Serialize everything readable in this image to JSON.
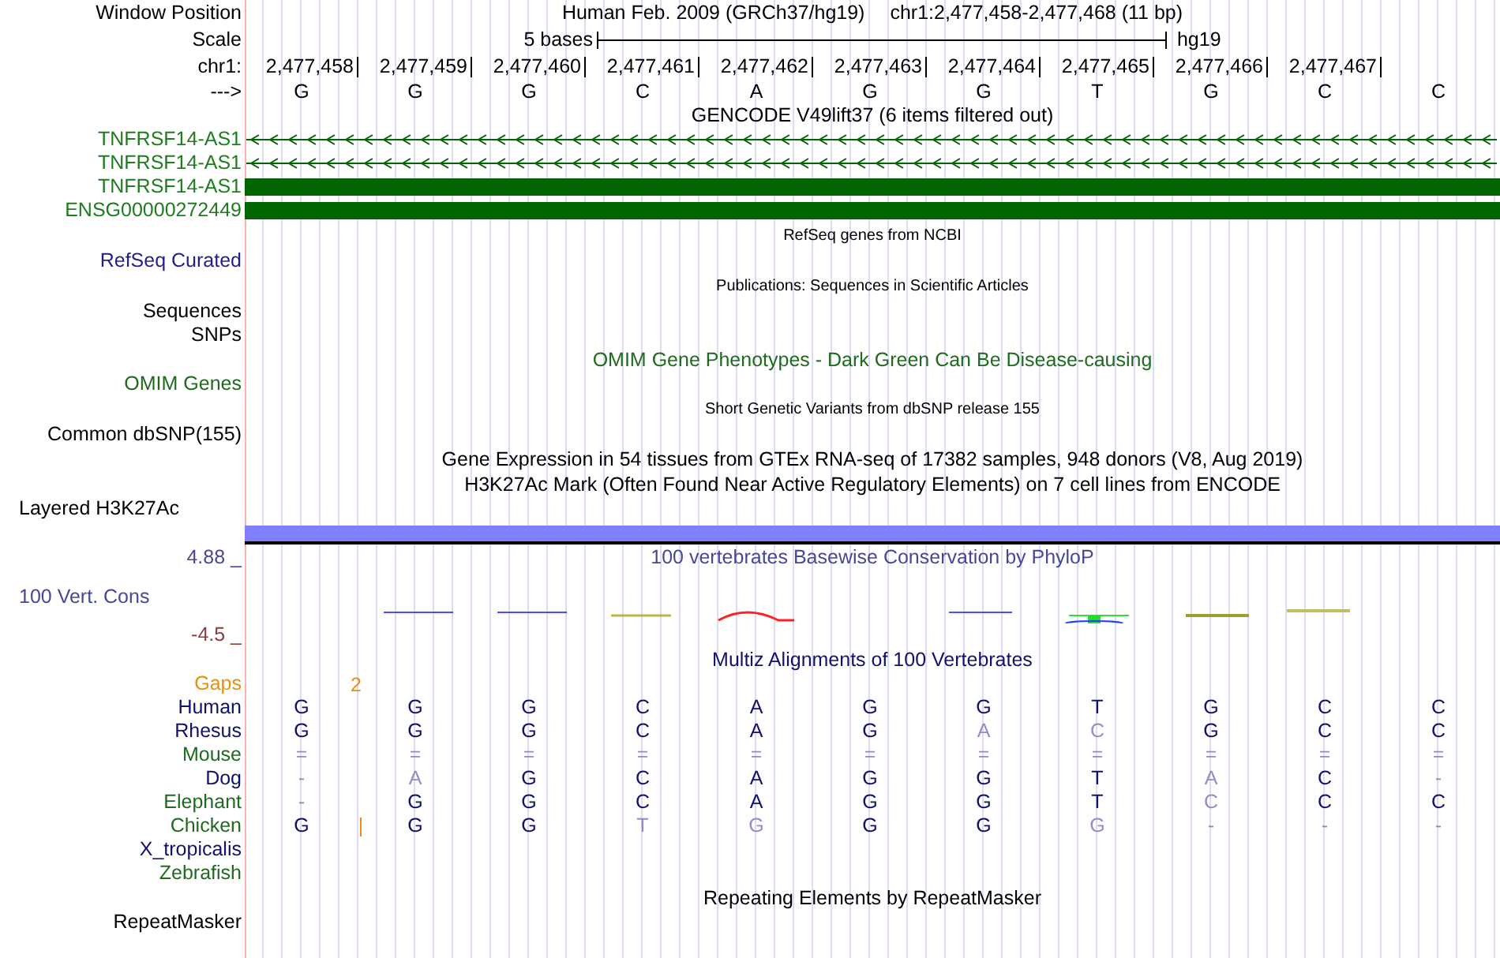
{
  "header": {
    "label": "Window Position",
    "assembly": "Human Feb. 2009 (GRCh37/hg19)",
    "position": "chr1:2,477,458-2,477,468 (11 bp)"
  },
  "scale": {
    "label": "Scale",
    "ruler_text": "5 bases",
    "assembly": "hg19"
  },
  "coordinates": {
    "label": "chr1:",
    "positions": [
      "2,477,458",
      "2,477,459",
      "2,477,460",
      "2,477,461",
      "2,477,462",
      "2,477,463",
      "2,477,464",
      "2,477,465",
      "2,477,466",
      "2,477,467"
    ]
  },
  "sequence": {
    "label": "--->",
    "bases": [
      "G",
      "G",
      "G",
      "C",
      "A",
      "G",
      "G",
      "T",
      "G",
      "C",
      "C"
    ]
  },
  "tracks": [
    {
      "kind": "title",
      "text": "GENCODE V49lift37 (6 items filtered out)",
      "color": "#000000"
    },
    {
      "kind": "gene-intron",
      "label": "TNFRSF14-AS1",
      "color": "#1e7d1e"
    },
    {
      "kind": "gene-intron",
      "label": "TNFRSF14-AS1",
      "color": "#1e7d1e"
    },
    {
      "kind": "gene-exon",
      "label": "TNFRSF14-AS1",
      "color": "#1e7d1e"
    },
    {
      "kind": "gene-exon",
      "label": "ENSG00000272449",
      "color": "#1e7d1e"
    },
    {
      "kind": "note",
      "text": "RefSeq genes from NCBI",
      "color": "#000000"
    },
    {
      "kind": "label",
      "label": "RefSeq Curated",
      "color": "#1f1f8c"
    },
    {
      "kind": "note",
      "text": "Publications: Sequences in Scientific Articles",
      "color": "#000000"
    },
    {
      "kind": "label",
      "label": "Sequences",
      "color": "#000000"
    },
    {
      "kind": "label",
      "label": "SNPs",
      "color": "#000000"
    },
    {
      "kind": "title",
      "text": "OMIM Gene Phenotypes - Dark Green Can Be Disease-causing",
      "color": "#1e6b1e"
    },
    {
      "kind": "label",
      "label": "OMIM Genes",
      "color": "#1e6b1e"
    },
    {
      "kind": "note",
      "text": "Short Genetic Variants from dbSNP release 155",
      "color": "#000000"
    },
    {
      "kind": "label",
      "label": "Common dbSNP(155)",
      "color": "#000000"
    },
    {
      "kind": "title",
      "text": "Gene Expression in 54 tissues from GTEx RNA-seq of 17382 samples, 948 donors (V8, Aug 2019)",
      "color": "#000000"
    },
    {
      "kind": "title",
      "text": "H3K27Ac Mark (Often Found Near Active Regulatory Elements) on 7 cell lines from ENCODE",
      "color": "#000000"
    },
    {
      "kind": "side-label",
      "label": "Layered H3K27Ac",
      "color": "#000000"
    },
    {
      "kind": "signal-bar",
      "color": "#7f7fff"
    },
    {
      "kind": "axis",
      "label": "4.88 _",
      "text": "100 vertebrates Basewise Conservation by PhyloP",
      "color": "#47479a"
    },
    {
      "kind": "wiggle",
      "label": "100 Vert. Cons",
      "color": "#47479a"
    },
    {
      "kind": "axis",
      "label": "-4.5 _",
      "color": "#8a3b3b"
    },
    {
      "kind": "title",
      "text": "Multiz Alignments of 100 Vertebrates",
      "color": "#10106e"
    },
    {
      "kind": "gaps",
      "label": "Gaps",
      "color": "#e8900a",
      "count": "2"
    },
    {
      "kind": "species",
      "label": "Human",
      "color": "#10106e",
      "bases": [
        {
          "b": "G",
          "faint": false
        },
        {
          "b": "G",
          "faint": false
        },
        {
          "b": "G",
          "faint": false
        },
        {
          "b": "C",
          "faint": false
        },
        {
          "b": "A",
          "faint": false
        },
        {
          "b": "G",
          "faint": false
        },
        {
          "b": "G",
          "faint": false
        },
        {
          "b": "T",
          "faint": false
        },
        {
          "b": "G",
          "faint": false
        },
        {
          "b": "C",
          "faint": false
        },
        {
          "b": "C",
          "faint": false
        }
      ]
    },
    {
      "kind": "species",
      "label": "Rhesus",
      "color": "#10106e",
      "bases": [
        {
          "b": "G",
          "faint": false
        },
        {
          "b": "G",
          "faint": false
        },
        {
          "b": "G",
          "faint": false
        },
        {
          "b": "C",
          "faint": false
        },
        {
          "b": "A",
          "faint": false
        },
        {
          "b": "G",
          "faint": false
        },
        {
          "b": "A",
          "faint": true
        },
        {
          "b": "C",
          "faint": true
        },
        {
          "b": "G",
          "faint": false
        },
        {
          "b": "C",
          "faint": false
        },
        {
          "b": "C",
          "faint": false
        }
      ]
    },
    {
      "kind": "species",
      "label": "Mouse",
      "color": "#1e6b1e",
      "bases": [
        {
          "b": "=",
          "faint": true
        },
        {
          "b": "=",
          "faint": true
        },
        {
          "b": "=",
          "faint": true
        },
        {
          "b": "=",
          "faint": true
        },
        {
          "b": "=",
          "faint": true
        },
        {
          "b": "=",
          "faint": true
        },
        {
          "b": "=",
          "faint": true
        },
        {
          "b": "=",
          "faint": true
        },
        {
          "b": "=",
          "faint": true
        },
        {
          "b": "=",
          "faint": true
        },
        {
          "b": "=",
          "faint": true
        }
      ]
    },
    {
      "kind": "species",
      "label": "Dog",
      "color": "#10106e",
      "bases": [
        {
          "b": "-",
          "faint": true
        },
        {
          "b": "A",
          "faint": true
        },
        {
          "b": "G",
          "faint": false
        },
        {
          "b": "C",
          "faint": false
        },
        {
          "b": "A",
          "faint": false
        },
        {
          "b": "G",
          "faint": false
        },
        {
          "b": "G",
          "faint": false
        },
        {
          "b": "T",
          "faint": false
        },
        {
          "b": "A",
          "faint": true
        },
        {
          "b": "C",
          "faint": false
        },
        {
          "b": "-",
          "faint": true
        }
      ]
    },
    {
      "kind": "species",
      "label": "Elephant",
      "color": "#1e6b1e",
      "bases": [
        {
          "b": "-",
          "faint": true
        },
        {
          "b": "G",
          "faint": false
        },
        {
          "b": "G",
          "faint": false
        },
        {
          "b": "C",
          "faint": false
        },
        {
          "b": "A",
          "faint": false
        },
        {
          "b": "G",
          "faint": false
        },
        {
          "b": "G",
          "faint": false
        },
        {
          "b": "T",
          "faint": false
        },
        {
          "b": "C",
          "faint": true
        },
        {
          "b": "C",
          "faint": false
        },
        {
          "b": "C",
          "faint": false
        }
      ]
    },
    {
      "kind": "species",
      "label": "Chicken",
      "color": "#1e6b1e",
      "bases": [
        {
          "b": "G",
          "faint": false,
          "insert_after": true
        },
        {
          "b": "G",
          "faint": false,
          "insert_after": false
        },
        {
          "b": "G",
          "faint": false,
          "insert_after": false
        },
        {
          "b": "T",
          "faint": true,
          "insert_after": false
        },
        {
          "b": "G",
          "faint": true,
          "insert_after": false
        },
        {
          "b": "G",
          "faint": false,
          "insert_after": false
        },
        {
          "b": "G",
          "faint": false,
          "insert_after": false
        },
        {
          "b": "G",
          "faint": true,
          "insert_after": false
        },
        {
          "b": "-",
          "faint": true,
          "insert_after": false
        },
        {
          "b": "-",
          "faint": true,
          "insert_after": false
        },
        {
          "b": "-",
          "faint": true,
          "insert_after": false
        }
      ]
    },
    {
      "kind": "species",
      "label": "X_tropicalis",
      "color": "#10106e"
    },
    {
      "kind": "species",
      "label": "Zebrafish",
      "color": "#1e6b1e"
    },
    {
      "kind": "title",
      "text": "Repeating Elements by RepeatMasker",
      "color": "#000000"
    },
    {
      "kind": "label",
      "label": "RepeatMasker",
      "color": "#000000"
    }
  ]
}
